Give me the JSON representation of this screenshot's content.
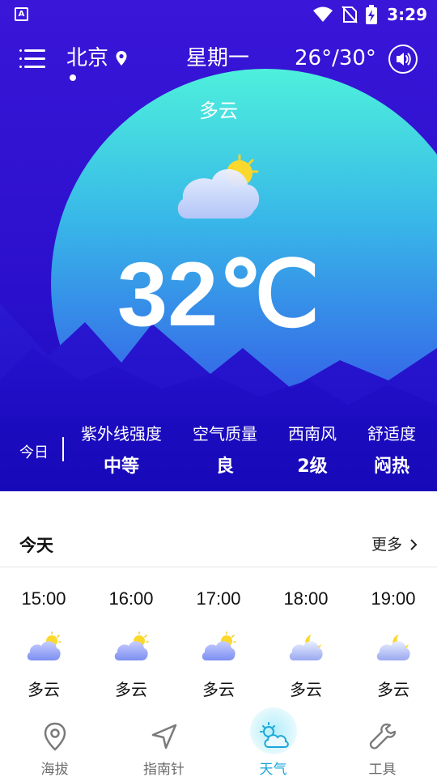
{
  "status_bar": {
    "time": "3:29",
    "app_icon_letter": "A"
  },
  "header": {
    "city": "北京",
    "weekday": "星期一",
    "temp_range": "26°/30°"
  },
  "current": {
    "condition": "多云",
    "temperature": "32℃"
  },
  "stats": {
    "today_label": "今日",
    "items": [
      {
        "label": "紫外线强度",
        "value": "中等"
      },
      {
        "label": "空气质量",
        "value": "良"
      },
      {
        "label": "西南风",
        "value": "2级"
      },
      {
        "label": "舒适度",
        "value": "闷热"
      }
    ]
  },
  "forecast": {
    "title": "今天",
    "more_label": "更多",
    "hours": [
      {
        "time": "15:00",
        "condition": "多云",
        "icon": "cloud-sun-icon"
      },
      {
        "time": "16:00",
        "condition": "多云",
        "icon": "cloud-sun-icon"
      },
      {
        "time": "17:00",
        "condition": "多云",
        "icon": "cloud-sun-icon"
      },
      {
        "time": "18:00",
        "condition": "多云",
        "icon": "cloud-moon-icon"
      },
      {
        "time": "19:00",
        "condition": "多云",
        "icon": "cloud-moon-icon"
      }
    ]
  },
  "bottom_nav": {
    "items": [
      {
        "label": "海拔",
        "icon": "location-pin-icon"
      },
      {
        "label": "指南针",
        "icon": "navigation-arrow-icon"
      },
      {
        "label": "天气",
        "icon": "weather-icon",
        "active": true
      },
      {
        "label": "工具",
        "icon": "wrench-icon"
      }
    ]
  },
  "colors": {
    "hero_top": "#3a16d8",
    "sphere_cyan": "#4ee8e0",
    "mountain": "#1808b8",
    "active_nav": "#1aa8d8"
  }
}
